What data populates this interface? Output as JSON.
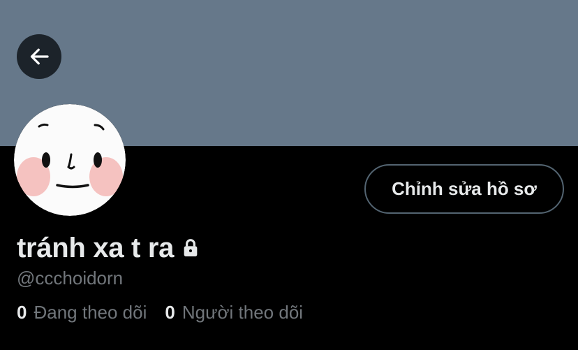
{
  "colors": {
    "banner": "#66788a",
    "background": "#000000",
    "primary_text": "#e7e9ea",
    "secondary_text": "#71767b",
    "button_border": "#536471"
  },
  "header": {
    "back_icon": "arrow-left-icon"
  },
  "profile": {
    "edit_button_label": "Chỉnh sửa hồ sơ",
    "display_name": "tránh xa t ra",
    "protected_icon": "lock-icon",
    "handle": "@ccchoidorn",
    "following": {
      "count": "0",
      "label": "Đang theo dõi"
    },
    "followers": {
      "count": "0",
      "label": "Người theo dõi"
    }
  }
}
